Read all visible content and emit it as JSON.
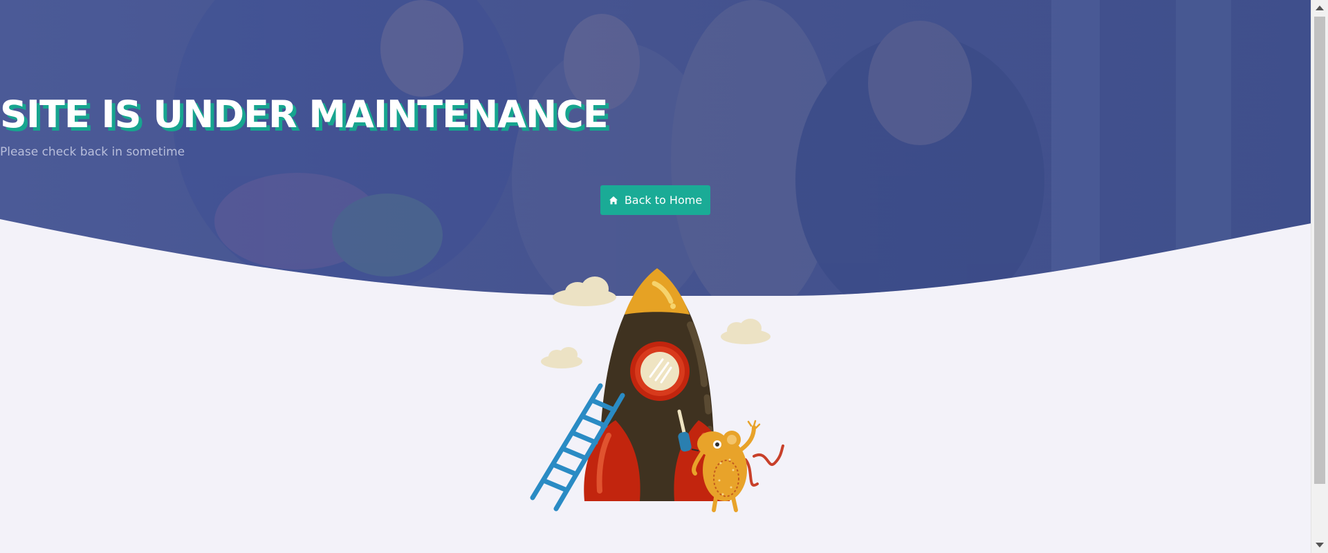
{
  "hero": {
    "title": "SITE IS UNDER MAINTENANCE",
    "subtitle": "Please check back in sometime",
    "button": {
      "label": "Back to Home",
      "icon": "home-icon"
    }
  },
  "colors": {
    "hero_overlay": "#46548f",
    "title_shadow": "#17a58f",
    "button_bg": "#1aab96",
    "page_bg": "#f3f2f9"
  },
  "illustration": {
    "subject": "rocket-with-ladder-and-mouse"
  }
}
